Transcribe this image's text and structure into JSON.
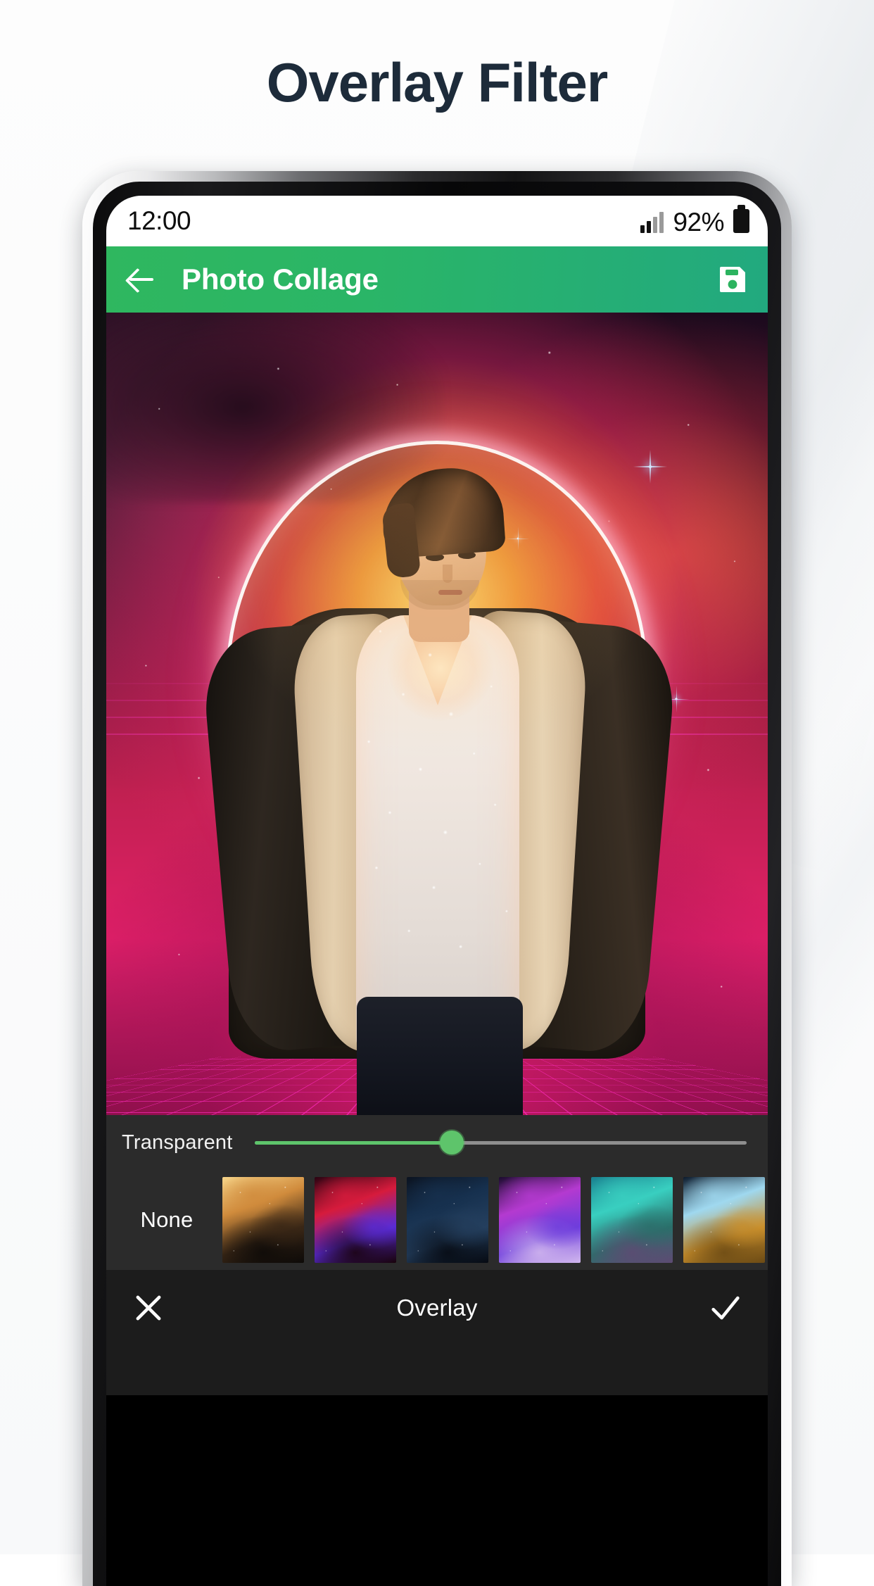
{
  "page": {
    "headline": "Overlay Filter",
    "headline_color": "#1d2b3a",
    "background_color": "#fcfcfd"
  },
  "phone": {
    "status_bar": {
      "clock": "12:00",
      "battery_percent": "92%",
      "signal_icon": "signal-bars-icon",
      "battery_icon": "battery-full-icon",
      "background_color": "#ffffff",
      "text_color": "#0d0d0d"
    },
    "app_bar": {
      "back_icon": "back-arrow-icon",
      "title": "Photo Collage",
      "save_icon": "save-floppy-icon",
      "background_color": "#2bb35f",
      "text_color": "#ffffff"
    },
    "canvas": {
      "description": "Synthwave overlay composite: young man in sherpa denim jacket, white tee and dark jeans, in front of an orange-pink nebula with a glowing white ring halo and a magenta perspective grid floor",
      "halo_color": "#ffffff",
      "grid_color": "#ff28be"
    },
    "controls": {
      "slider": {
        "label": "Transparent",
        "value_percent": 40,
        "fill_color": "#5ec46b",
        "track_color": "#8e8e8e",
        "thumb_color": "#5ec46b"
      },
      "thumbnails": {
        "none_label": "None",
        "items": [
          {
            "name": "thumb-golden-nebula",
            "colors": [
              "#f6d489",
              "#d08b3c",
              "#3a2716",
              "#0d0a08"
            ]
          },
          {
            "name": "thumb-crimson-vortex",
            "colors": [
              "#2a0412",
              "#d61b3c",
              "#5a2bd4",
              "#18020a"
            ]
          },
          {
            "name": "thumb-deep-blue",
            "colors": [
              "#0b1320",
              "#16304e",
              "#243f5e",
              "#060a12"
            ]
          },
          {
            "name": "thumb-violet-cloud",
            "colors": [
              "#1b0c2e",
              "#b43ad0",
              "#6e3ddc",
              "#d2b8ee"
            ]
          },
          {
            "name": "thumb-teal-mist",
            "colors": [
              "#19808f",
              "#39cfc0",
              "#2a6f6a",
              "#5e4a73"
            ]
          },
          {
            "name": "thumb-amber-ridge",
            "colors": [
              "#0c1a2c",
              "#9fd8ef",
              "#c98f2c",
              "#6b4a14"
            ]
          }
        ]
      },
      "panel_color": "#2b2b2b"
    },
    "bottom_bar": {
      "cancel_icon": "close-x-icon",
      "title": "Overlay",
      "confirm_icon": "check-icon",
      "background_color": "#1c1c1c",
      "text_color": "#ffffff"
    }
  }
}
